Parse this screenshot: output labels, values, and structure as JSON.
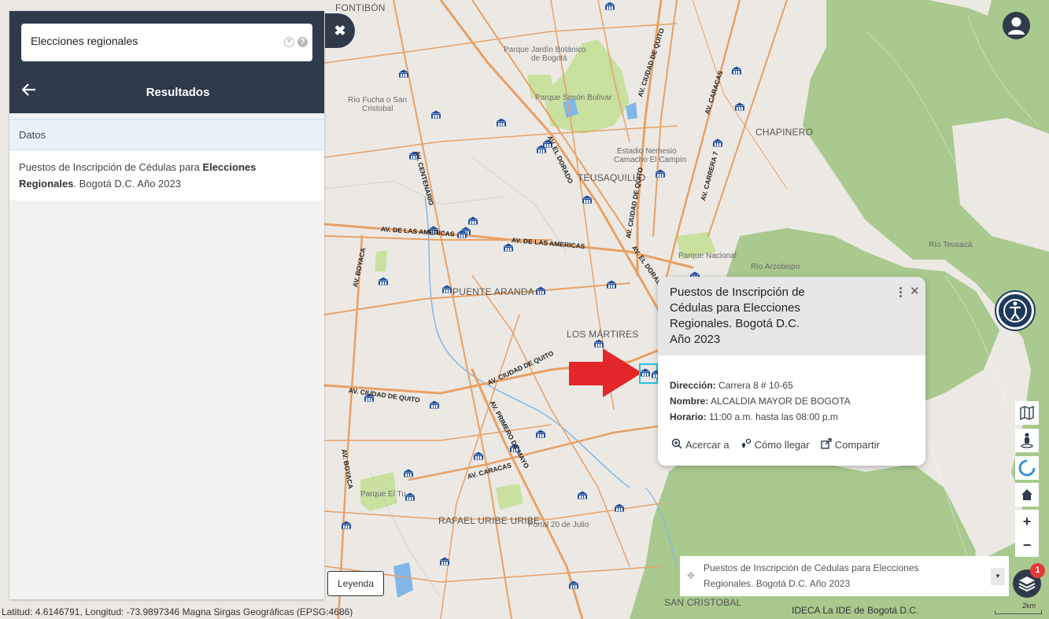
{
  "search": {
    "value": "Elecciones regionales"
  },
  "panel": {
    "title": "Resultados",
    "data_header": "Datos",
    "result": {
      "text_prefix": "Puestos de Inscripción de Cédulas para ",
      "text_bold": "Elecciones Regionales",
      "text_suffix": ". Bogotá D.C. Año 2023"
    }
  },
  "popup": {
    "title": "Puestos de Inscripción de Cédulas para Elecciones Regionales. Bogotá D.C. Año 2023",
    "fields": [
      {
        "label": "Dirección:",
        "value": "Carrera 8 # 10-65"
      },
      {
        "label": "Nombre:",
        "value": "ALCALDIA MAYOR DE BOGOTA"
      },
      {
        "label": "Horario:",
        "value": "11:00 a.m. hasta las 08:00 p.m"
      }
    ],
    "actions": {
      "zoom": "Acercar a",
      "directions": "Cómo llegar",
      "share": "Compartir"
    }
  },
  "map": {
    "districts": {
      "fontibon": "FONTIBÓN",
      "teusaquillo": "TEUSAQUILLO",
      "chapinero": "CHAPINERO",
      "puente_aranda": "PUENTE ARANDA",
      "los_martires": "LOS MÁRTIRES",
      "rafael_uribe": "RAFAEL URIBE URIBE",
      "san_cristobal": "SAN CRISTOBAL"
    },
    "places": {
      "jardin_botanico_1": "Parque Jardín Botánico",
      "jardin_botanico_2": "de Bogotá",
      "simon_bolivar": "Parque Simón Bolívar",
      "estadio_1": "Estadio Nemesio",
      "estadio_2": "Camacho El Campín",
      "parque_nacional": "Parque Nacional",
      "rio_arzobispo": "Río Arzobispo",
      "rio_teusaca": "Río Teusacá",
      "rio_fucha_1": "Río Fucha o San",
      "rio_fucha_2": "Cristobal",
      "parque_tunal": "Parque El Tu",
      "portal_20": "Portal 20 de Julio"
    },
    "roads": {
      "centenario": "AV. CENTENARIO",
      "el_dorado_1": "AV. EL DORADO",
      "el_dorado_2": "AV. EL DORADO",
      "quito_1": "AV. CIUDAD DE QUITO",
      "quito_2": "AV. CIUDAD DE QUITO",
      "quito_3": "AV. CIUDAD DE QUITO",
      "quito_4": "AV. CIUDAD DE QUITO",
      "caracas_1": "AV. CARACAS",
      "caracas_2": "AV. CARACAS",
      "carrera7": "AV. CARRERA 7",
      "americas_1": "AV. DE LAS AMERICAS",
      "americas_2": "AV. DE LAS AMERICAS",
      "boyaca_1": "AV. BOYACA",
      "boyaca_2": "AV. BOYACA",
      "primero_mayo": "AV. PRIMERO DE MAYO"
    }
  },
  "layer_selector": {
    "text": "Puestos de Inscripción de Cédulas para Elecciones Regionales. Bogotá D.C. Año 2023"
  },
  "legend_label": "Leyenda",
  "layers_badge": "1",
  "coordinates": "Latitud: 4.6146791, Longitud: -73.9897346 Magna Sirgas Geográficas (EPSG:4686)",
  "attribution": "IDECA La IDE de Bogotá D.C.",
  "scale": "2km",
  "colors": {
    "panel_dark": "#2f3a4b",
    "road": "#e8a065",
    "green_area": "#a7c98f",
    "poi": "#1f4e9e",
    "arrow": "#e3262a",
    "badge": "#e53a3a"
  }
}
